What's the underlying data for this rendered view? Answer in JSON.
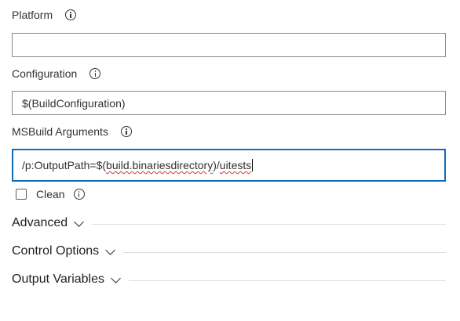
{
  "fields": {
    "platform": {
      "label": "Platform",
      "value": ""
    },
    "configuration": {
      "label": "Configuration",
      "value": "$(BuildConfiguration)"
    },
    "msbuild_arguments": {
      "label": "MSBuild Arguments",
      "value_prefix": "/p:OutputPath=$(",
      "value_misspelled_1": "build.binariesdirectory",
      "value_mid": ")/",
      "value_misspelled_2": "uitests"
    }
  },
  "clean": {
    "label": "Clean",
    "checked": false
  },
  "sections": [
    {
      "title": "Advanced"
    },
    {
      "title": "Control Options"
    },
    {
      "title": "Output Variables"
    }
  ],
  "icons": {
    "info": "info-icon",
    "chevron": "chevron-down-icon"
  },
  "colors": {
    "focus_border": "#0f6cbd",
    "input_border": "#8a8886",
    "spellcheck_underline": "#d13438"
  }
}
